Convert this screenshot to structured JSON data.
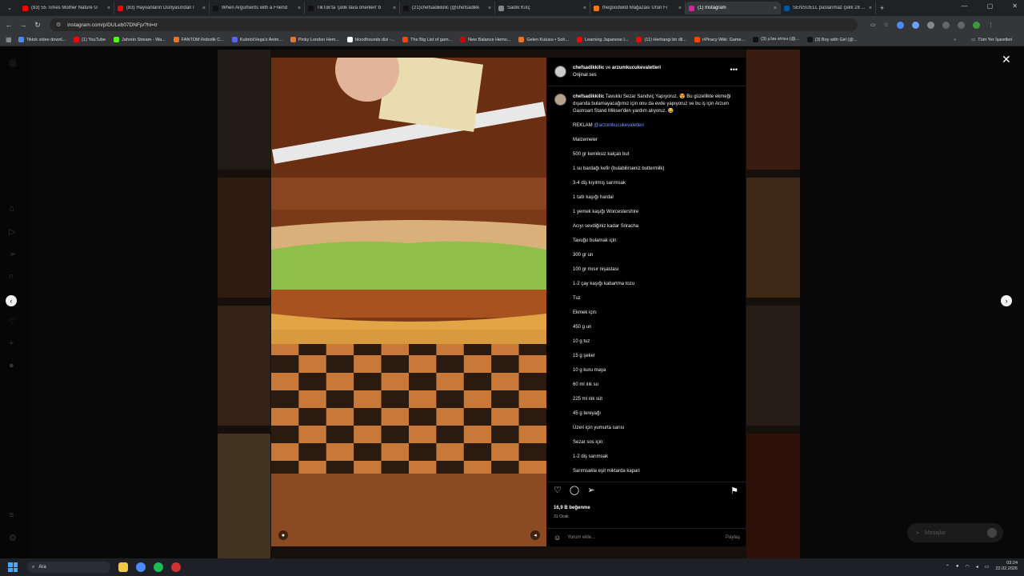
{
  "browser": {
    "tabs": [
      {
        "title": "(83) 55 Times Mother Nature G",
        "color": "#ff0000"
      },
      {
        "title": "(83) Hayvanların Dünyasından İ",
        "color": "#ff0000"
      },
      {
        "title": "When Arguments with a Friend",
        "color": "#111111"
      },
      {
        "title": "TikTok'ta 'çelik tava önerileri' b",
        "color": "#111111"
      },
      {
        "title": "(21)chefsadikkilic (@chefsadikk",
        "color": "#111111"
      },
      {
        "title": "Sadık Kılıç",
        "color": "#888888"
      },
      {
        "title": "thegoodwild Mağazası Ürün Fi",
        "color": "#f27a1a"
      },
      {
        "title": "(1) Instagram",
        "color": "#d6249f",
        "active": true
      },
      {
        "title": "SENSUELL paslanmaz çelik 28 ...",
        "color": "#0058a3"
      }
    ],
    "tab_close": "×",
    "new_tab": "+",
    "url": "instagram.com/p/DULeb07DNFp/?hl=tr",
    "bookmarks": [
      {
        "label": "Tiktok video downl...",
        "color": "#4a8cff"
      },
      {
        "label": "(1) YouTube",
        "color": "#ff0000"
      },
      {
        "label": "Jahrein Stream - Wa...",
        "color": "#53fc18"
      },
      {
        "label": "FANTOM Robotik C...",
        "color": "#e8742a"
      },
      {
        "label": "KubrickVega's Anim...",
        "color": "#5865f2"
      },
      {
        "label": "Pinky London Hem...",
        "color": "#e8742a"
      },
      {
        "label": "bloodhounds dizi -...",
        "color": "#ffffff"
      },
      {
        "label": "The Big List of gam...",
        "color": "#ff4500"
      },
      {
        "label": "New Balance Hemo...",
        "color": "#cc0000"
      },
      {
        "label": "Gelen Kutusu • Soh...",
        "color": "#e8742a"
      },
      {
        "label": "Learning Japanese I...",
        "color": "#ff0000"
      },
      {
        "label": "(11) Herhangi bir dil...",
        "color": "#ff0000"
      },
      {
        "label": "r/Piracy Wiki: Game...",
        "color": "#ff4500"
      },
      {
        "label": "(3) 𝔷𝔢𝔟𝔞𝔰 𝔵𝔬𝔯𝔫𝔢𝔰 (@...",
        "color": "#111111"
      },
      {
        "label": "(3) Boy with Girl (@...",
        "color": "#111111"
      }
    ],
    "bookmarks_more": "»",
    "all_bookmarks": "Tüm Yer İşaretleri"
  },
  "post": {
    "header_users": "chefsadikkilic",
    "header_and": "ve",
    "header_collab": "arzumkucukevaletleri",
    "audio": "Orijinal ses",
    "caption_user": "chefsadikkilic",
    "caption_text": "Tavuklu Sezar Sandviç Yapıyoruz. 😍 Bu güzellikte ekmeği dışarıda bulamayacağımız için onu da evde yapıyoruz ve bu iş için Arzum Gastroart Stand Mikser'den yardım alıyoruz. 😂",
    "ad_label": "REKLAM",
    "ad_tag": "@arzumkucukevaletleri",
    "ingredients": [
      "Malzemeler",
      "500 gr kemiksiz kalçalı but",
      "1 su bardağı kefir (bulabilirseniz buttermilk)",
      "3-4 diş kıyılmış sarımsak",
      "1 tatlı kaşığı hardal",
      "1 yemek kaşığı Worcestershire",
      "Acıyı sevdiğiniz kadar Sriracha",
      "Tavuğu bulamak için:",
      "300 gr un",
      "100 gr mısır nişastası",
      "1-2 çay kaşığı kabartma tozu",
      "Tuz",
      "Ekmek için:",
      "450 g un",
      "10 g tuz",
      "15 g şeker",
      "10 g kuru maya",
      "60 ml ılık su",
      "225 ml ılık süt",
      "45 g tereyağı",
      "Üzeri için yumurta sarısı",
      "Sezar sos için:",
      "1-2 diş sarımsak",
      "Sarımsakla eşit miktarda kapari"
    ],
    "likes": "16,9 B beğenme",
    "date": "31 Ocak",
    "comment_placeholder": "Yorum ekle...",
    "share": "Paylaş"
  },
  "messages_label": "Mesajlar",
  "taskbar": {
    "search": "Ara",
    "time": "03:24",
    "date": "22.02.2026"
  }
}
